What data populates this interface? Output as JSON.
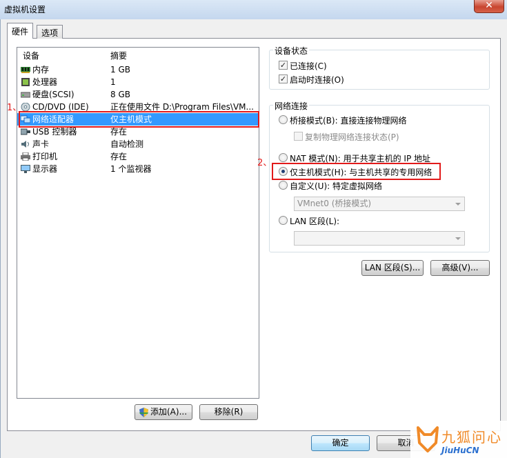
{
  "window": {
    "title": "虚拟机设置",
    "close_label": "✕"
  },
  "tabs": [
    {
      "label": "硬件"
    },
    {
      "label": "选项"
    }
  ],
  "device_list": {
    "col_device": "设备",
    "col_summary": "摘要",
    "rows": [
      {
        "name": "内存",
        "summary": "1 GB",
        "icon": "memory-icon"
      },
      {
        "name": "处理器",
        "summary": "1",
        "icon": "processor-icon"
      },
      {
        "name": "硬盘(SCSI)",
        "summary": "8 GB",
        "icon": "harddisk-icon"
      },
      {
        "name": "CD/DVD (IDE)",
        "summary": "正在使用文件 D:\\Program Files\\VM...",
        "icon": "cd-dvd-icon"
      },
      {
        "name": "网络适配器",
        "summary": "仅主机模式",
        "icon": "network-adapter-icon",
        "selected": true
      },
      {
        "name": "USB 控制器",
        "summary": "存在",
        "icon": "usb-icon"
      },
      {
        "name": "声卡",
        "summary": "自动检测",
        "icon": "sound-card-icon"
      },
      {
        "name": "打印机",
        "summary": "存在",
        "icon": "printer-icon"
      },
      {
        "name": "显示器",
        "summary": "1 个监视器",
        "icon": "display-icon"
      }
    ]
  },
  "annotations": {
    "one": "1、",
    "two": "2、",
    "color": "#e21a1a"
  },
  "device_status": {
    "title": "设备状态",
    "connected": {
      "label": "已连接(C)",
      "checked": true
    },
    "connect_at_power_on": {
      "label": "启动时连接(O)",
      "checked": true
    }
  },
  "network_connection": {
    "title": "网络连接",
    "bridged": {
      "label": "桥接模式(B): 直接连接物理网络",
      "selected": false
    },
    "replicate": {
      "label": "复制物理网络连接状态(P)",
      "checked": false,
      "disabled": true
    },
    "nat": {
      "label": "NAT 模式(N): 用于共享主机的 IP 地址",
      "selected": false
    },
    "host_only": {
      "label": "仅主机模式(H): 与主机共享的专用网络",
      "selected": true
    },
    "custom": {
      "label": "自定义(U): 特定虚拟网络",
      "selected": false
    },
    "custom_combo_value": "VMnet0 (桥接模式)",
    "lan_segment": {
      "label": "LAN 区段(L):",
      "selected": false
    },
    "lan_combo_value": ""
  },
  "buttons": {
    "lan_segments": "LAN 区段(S)...",
    "advanced": "高级(V)...",
    "add": "添加(A)...",
    "remove": "移除(R)",
    "ok": "确定",
    "cancel": "取消"
  },
  "watermark": {
    "cn": "九狐问心",
    "en": "JiuHuCN"
  },
  "colors": {
    "selection": "#3399ff",
    "accent": "#e21a1a",
    "watermark_orange": "#f08a28",
    "watermark_blue": "#2a6fcf"
  }
}
